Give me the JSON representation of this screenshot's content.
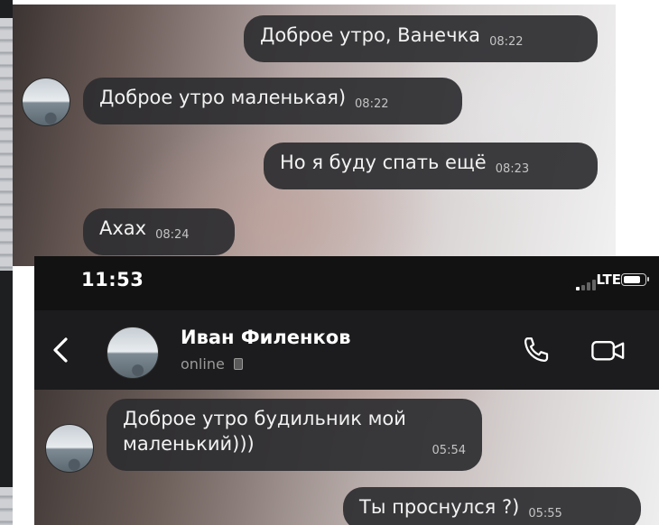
{
  "top_chat": {
    "messages": [
      {
        "text": "Доброе утро, Ванечка",
        "time": "08:22",
        "direction": "outgoing"
      },
      {
        "text": "Доброе утро маленькая)",
        "time": "08:22",
        "direction": "incoming"
      },
      {
        "text": "Но я буду спать ещё",
        "time": "08:23",
        "direction": "outgoing"
      },
      {
        "text": "Ахах",
        "time": "08:24",
        "direction": "incoming"
      }
    ]
  },
  "status_bar": {
    "time": "11:53",
    "network": "LTE",
    "signal_bars_active": 1,
    "signal_bars_total": 4,
    "battery_level": 0.8
  },
  "header": {
    "back_icon": "chevron-left-icon",
    "contact_name": "Иван Филенков",
    "status": "online",
    "status_icon": "device-icon",
    "call_icon": "phone-icon",
    "video_icon": "video-camera-icon"
  },
  "bottom_chat": {
    "messages": [
      {
        "line1": "Доброе утро будильник мой",
        "line2": "маленький)))",
        "time": "05:54",
        "direction": "incoming"
      },
      {
        "text": "Ты проснулся ?)",
        "time": "05:55",
        "direction": "outgoing"
      }
    ]
  },
  "colors": {
    "bubble": "#2d2d30",
    "header": "#1c1c1e",
    "status_bar": "#121212",
    "text": "#f2f2f2",
    "muted": "#9a9a9a"
  }
}
